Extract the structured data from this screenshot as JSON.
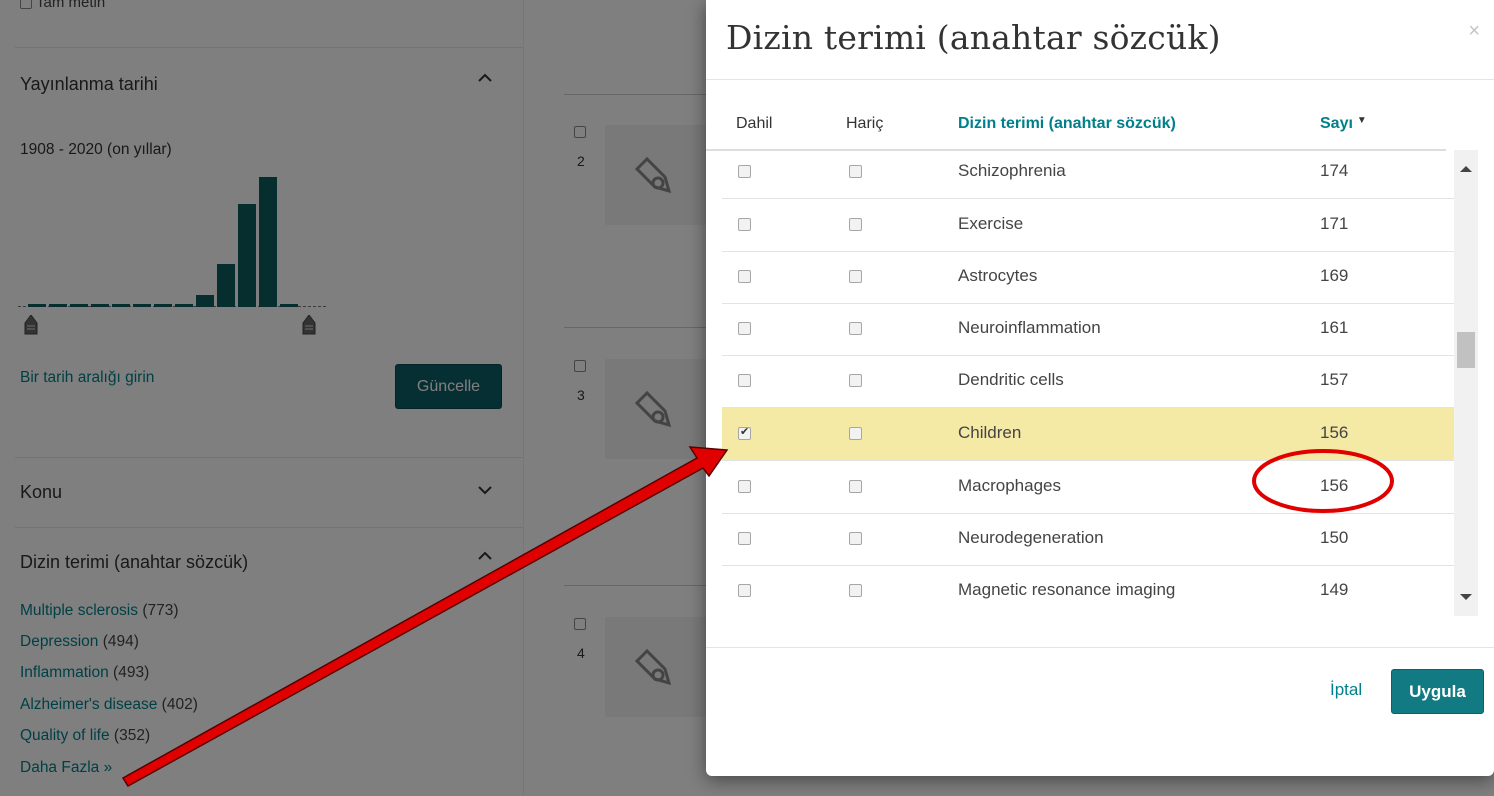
{
  "sidebar": {
    "tam_metin": "Tam metin",
    "date_section": {
      "title": "Yayınlanma tarihi",
      "range_label": "1908 - 2020 (on yıllar)",
      "histogram_values": [
        1,
        1,
        1,
        1,
        1,
        1,
        1,
        1,
        6,
        22,
        53,
        67,
        1
      ],
      "range_input_link": "Bir tarih aralığı girin",
      "update_button": "Güncelle"
    },
    "konu": {
      "title": "Konu"
    },
    "keyword_section": {
      "title": "Dizin terimi (anahtar sözcük)",
      "items": [
        {
          "label": "Multiple sclerosis",
          "count": "(773)"
        },
        {
          "label": "Depression",
          "count": "(494)"
        },
        {
          "label": "Inflammation",
          "count": "(493)"
        },
        {
          "label": "Alzheimer's disease",
          "count": "(402)"
        },
        {
          "label": "Quality of life",
          "count": "(352)"
        }
      ],
      "more_link": "Daha Fazla"
    }
  },
  "results": {
    "numbers": [
      "2",
      "3",
      "4"
    ]
  },
  "modal": {
    "title": "Dizin terimi (anahtar sözcük)",
    "close": "×",
    "columns": {
      "include": "Dahil",
      "exclude": "Hariç",
      "term": "Dizin terimi (anahtar sözcük)",
      "count": "Sayı"
    },
    "rows": [
      {
        "term": "Schizophrenia",
        "count": "174",
        "include": false
      },
      {
        "term": "Exercise",
        "count": "171",
        "include": false
      },
      {
        "term": "Astrocytes",
        "count": "169",
        "include": false
      },
      {
        "term": "Neuroinflammation",
        "count": "161",
        "include": false
      },
      {
        "term": "Dendritic cells",
        "count": "157",
        "include": false
      },
      {
        "term": "Children",
        "count": "156",
        "include": true
      },
      {
        "term": "Macrophages",
        "count": "156",
        "include": false
      },
      {
        "term": "Neurodegeneration",
        "count": "150",
        "include": false
      },
      {
        "term": "Magnetic resonance imaging",
        "count": "149",
        "include": false
      }
    ],
    "cancel": "İptal",
    "apply": "Uygula"
  },
  "colors": {
    "accent": "#00808a",
    "primary_button": "#117a82",
    "selected_row": "#f5e9a6",
    "histogram_bar": "#0d5c5c",
    "annotation": "#e00000"
  }
}
